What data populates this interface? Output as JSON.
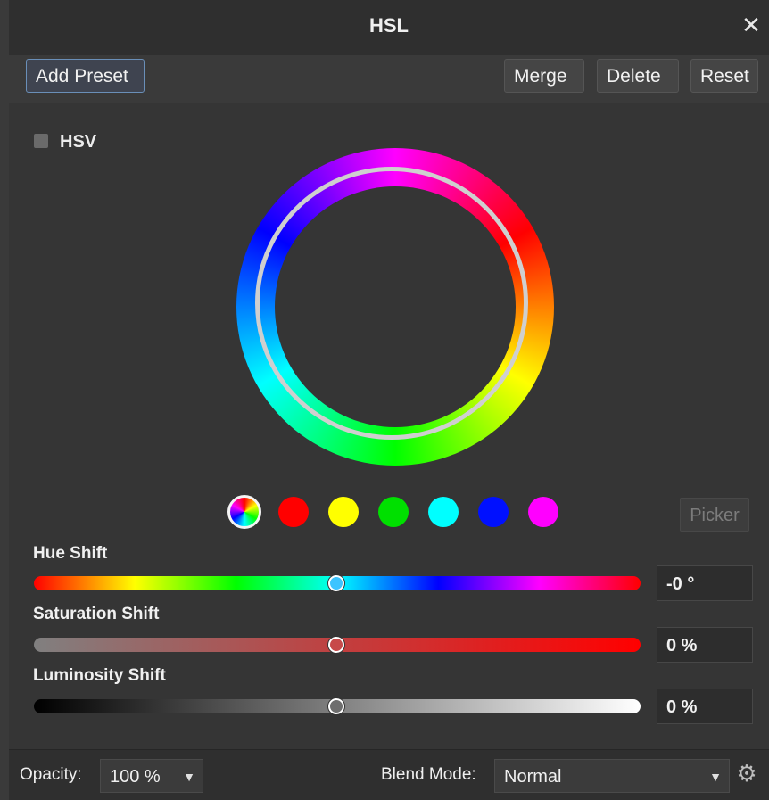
{
  "window": {
    "title": "HSL",
    "close_icon": "close-icon"
  },
  "toolbar": {
    "add_preset_label": "Add Preset",
    "merge_label": "Merge",
    "delete_label": "Delete",
    "reset_label": "Reset"
  },
  "options": {
    "hsv_label": "HSV",
    "hsv_checked": false
  },
  "color_wheel": {
    "icon": "color-wheel-icon"
  },
  "swatches": [
    {
      "name": "all",
      "color": "#multi"
    },
    {
      "name": "red",
      "color": "#ff0000"
    },
    {
      "name": "yellow",
      "color": "#ffff00"
    },
    {
      "name": "green",
      "color": "#00e000"
    },
    {
      "name": "cyan",
      "color": "#00ffff"
    },
    {
      "name": "blue",
      "color": "#0010ff"
    },
    {
      "name": "magenta",
      "color": "#ff00ff"
    }
  ],
  "picker_label": "Picker",
  "sliders": {
    "hue": {
      "label": "Hue Shift",
      "value": "-0 °",
      "position": 0.5
    },
    "saturation": {
      "label": "Saturation Shift",
      "value": "0 %",
      "position": 0.5
    },
    "luminosity": {
      "label": "Luminosity Shift",
      "value": "0 %",
      "position": 0.5
    }
  },
  "footer": {
    "opacity_label": "Opacity:",
    "opacity_value": "100 %",
    "blend_mode_label": "Blend Mode:",
    "blend_mode_value": "Normal",
    "settings_icon": "gear-icon"
  },
  "colors": {
    "accent": "#6a8fb8",
    "panel_bg": "#353535",
    "title_bg": "#2f2f2f"
  }
}
